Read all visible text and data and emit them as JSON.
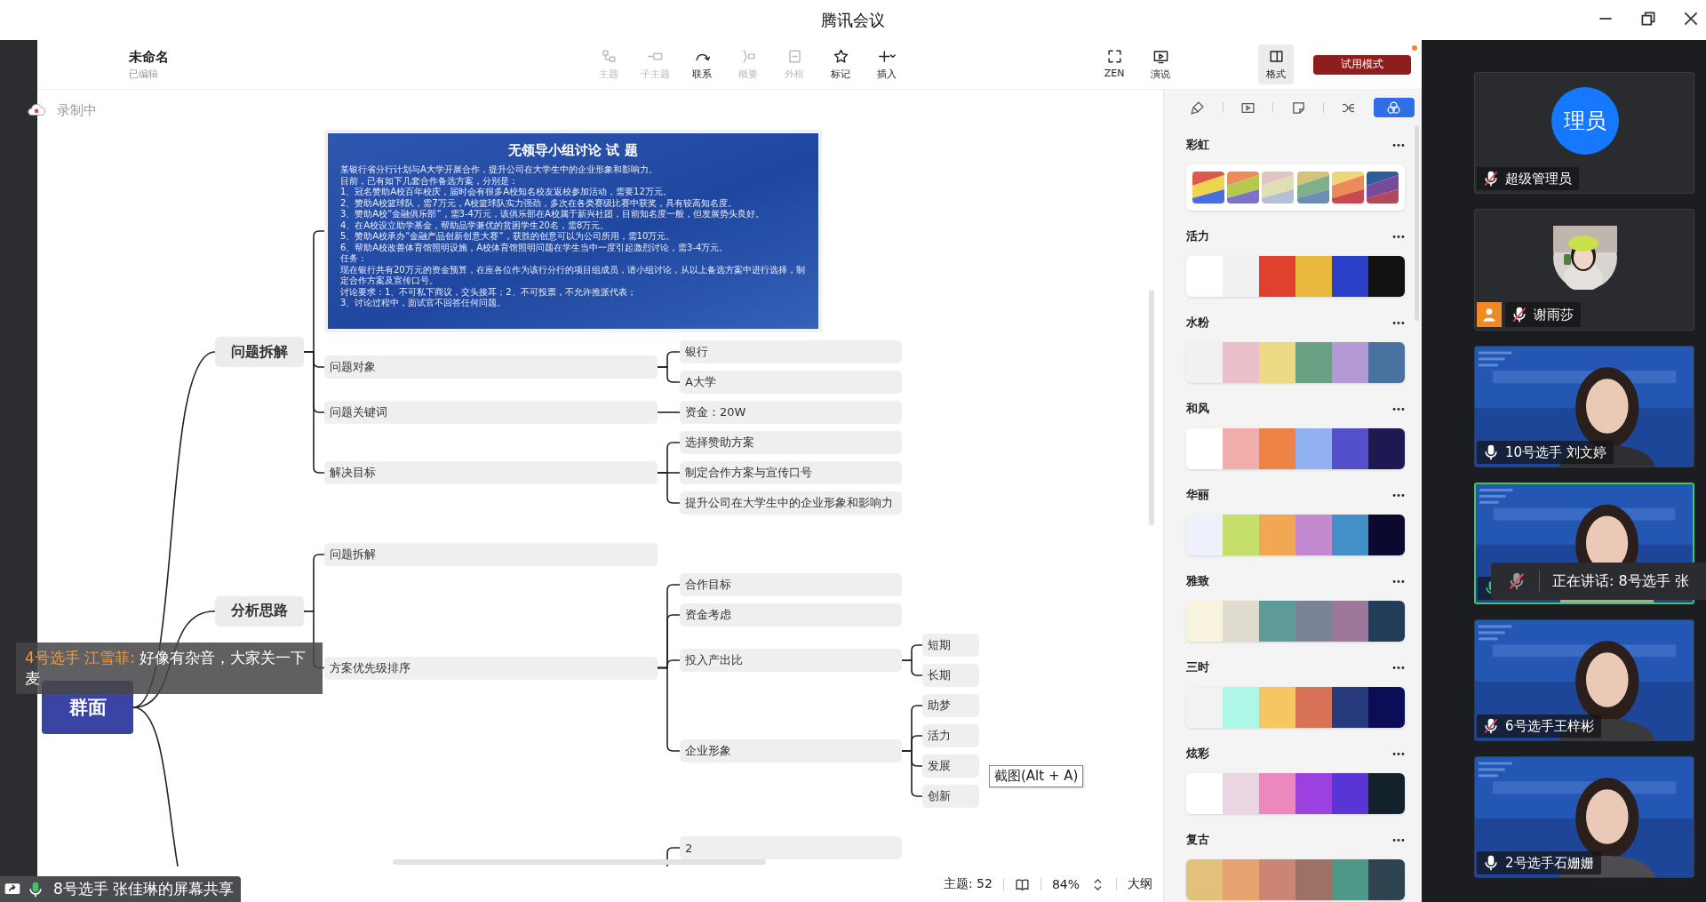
{
  "window": {
    "title": "腾讯会议"
  },
  "document": {
    "title": "未命名",
    "status": "已编辑"
  },
  "toolbar": {
    "tools": [
      {
        "label": "主题",
        "disabled": true
      },
      {
        "label": "子主题",
        "disabled": true
      },
      {
        "label": "联系",
        "disabled": false
      },
      {
        "label": "概要",
        "disabled": true
      },
      {
        "label": "外框",
        "disabled": true
      },
      {
        "label": "标记",
        "disabled": false
      },
      {
        "label": "插入",
        "disabled": false
      }
    ],
    "view_tools": [
      {
        "label": "ZEN"
      },
      {
        "label": "演说"
      }
    ],
    "format_tab": {
      "label": "格式",
      "selected": true
    },
    "trial_button": {
      "label": "试用模式",
      "notice": true
    }
  },
  "recording": {
    "label": "录制中"
  },
  "mindmap": {
    "root": {
      "kind": "topic",
      "text": "群面",
      "children": [
        {
          "kind": "topic",
          "text": "问题拆解",
          "children": [
            {
              "kind": "slide",
              "title": "无领导小组讨论 试 题",
              "lines": [
                "某银行省分行计划与A大学开展合作，提升公司在大学生中的企业形象和影响力。",
                "目前，已有如下几套合作备选方案，分别是：",
                "1、冠名赞助A校百年校庆，届时会有很多A校知名校友返校参加活动，需要12万元。",
                "2、赞助A校篮球队，需7万元，A校篮球队实力强劲，多次在各类赛级比赛中获奖，具有较高知名度。",
                "3、赞助A校“金融俱乐部”，需3-4万元，该俱乐部在A校属于新兴社团，目前知名度一般，但发展势头良好。",
                "4、在A校设立助学基金，帮助品学兼优的贫困学生20名，需8万元。",
                "5、赞助A校承办“金融产品创新创意大赛”，获胜的创意可以为公司所用，需10万元。",
                "6、帮助A校改善体育馆照明设施，A校体育馆照明问题在学生当中一度引起激烈讨论，需3-4万元。",
                "任务：",
                "现在银行共有20万元的资金预算，在座各位作为该行分行的项目组成员，请小组讨论，从以上备选方案中进行选择，制定合作方案及宣传口号。",
                "讨论要求：1、不可私下商议，交头接耳；2、不可投票，不允许推派代表；",
                "3、讨论过程中，面试官不回答任何问题。"
              ]
            },
            {
              "kind": "topic",
              "text": "问题对象",
              "children": [
                {
                  "kind": "topic",
                  "text": "银行"
                },
                {
                  "kind": "topic",
                  "text": "A大学"
                }
              ]
            },
            {
              "kind": "topic",
              "text": "问题关键词",
              "children": [
                {
                  "kind": "topic",
                  "text": "资金：20W"
                }
              ]
            },
            {
              "kind": "topic",
              "text": "解决目标",
              "children": [
                {
                  "kind": "topic",
                  "text": "选择赞助方案"
                },
                {
                  "kind": "topic",
                  "text": "制定合作方案与宣传口号"
                },
                {
                  "kind": "topic",
                  "text": "提升公司在大学生中的企业形象和影响力"
                }
              ]
            }
          ]
        },
        {
          "kind": "topic",
          "text": "分析思路",
          "children": [
            {
              "kind": "topic",
              "text": "问题拆解"
            },
            {
              "kind": "topic",
              "text": "方案优先级排序",
              "children": [
                {
                  "kind": "topic",
                  "text": "合作目标"
                },
                {
                  "kind": "topic",
                  "text": "资金考虑"
                },
                {
                  "kind": "topic",
                  "text": "投入产出比",
                  "children": [
                    {
                      "kind": "topic",
                      "text": "短期"
                    },
                    {
                      "kind": "topic",
                      "text": "长期"
                    }
                  ]
                },
                {
                  "kind": "topic",
                  "text": "企业形象",
                  "children": [
                    {
                      "kind": "topic",
                      "text": "助梦"
                    },
                    {
                      "kind": "topic",
                      "text": "活力"
                    },
                    {
                      "kind": "topic",
                      "text": "发展"
                    },
                    {
                      "kind": "topic",
                      "text": "创新"
                    }
                  ]
                }
              ]
            }
          ]
        },
        {
          "kind": "offscreen",
          "children": [
            {
              "kind": "offscreen",
              "children": [
                {
                  "kind": "topic",
                  "text": "2"
                }
              ]
            }
          ]
        }
      ]
    }
  },
  "screenshot_tooltip": "截图(Alt + A)",
  "status_bar": {
    "topic_count": "主题: 52",
    "zoom": "84%",
    "outline": "大纲"
  },
  "format_panel": {
    "tabs": [
      {
        "selected": false
      },
      {
        "selected": false
      },
      {
        "selected": false
      },
      {
        "selected": false
      },
      {
        "selected": true
      }
    ],
    "palettes": [
      {
        "name": "彩虹",
        "kind": "striped",
        "swatches": [
          {
            "bands": [
              {
                "color": "#e2574c"
              },
              {
                "color": "#eed54f"
              },
              {
                "color": "#4a6ee0"
              }
            ]
          },
          {
            "bands": [
              {
                "color": "#ed8b5b"
              },
              {
                "color": "#b6c94d"
              },
              {
                "color": "#7b74c4"
              }
            ]
          },
          {
            "bands": [
              {
                "color": "#e4c3c3"
              },
              {
                "color": "#dfe0b4"
              },
              {
                "color": "#b5c0d4"
              }
            ]
          },
          {
            "bands": [
              {
                "color": "#d6c27a"
              },
              {
                "color": "#7fb08a"
              },
              {
                "color": "#6a8fb0"
              }
            ]
          },
          {
            "bands": [
              {
                "color": "#efd67a"
              },
              {
                "color": "#ec8a5a"
              },
              {
                "color": "#c84a50"
              }
            ]
          },
          {
            "bands": [
              {
                "color": "#2f5d9a"
              },
              {
                "color": "#7a4a9a"
              },
              {
                "color": "#b04a5a"
              }
            ]
          }
        ]
      },
      {
        "name": "活力",
        "kind": "solid",
        "swatches": [
          {
            "color": "#ffffff"
          },
          {
            "color": "#f1f1f1"
          },
          {
            "color": "#e0412e"
          },
          {
            "color": "#e8b93d"
          },
          {
            "color": "#2b40c9"
          },
          {
            "color": "#111111"
          }
        ]
      },
      {
        "name": "水粉",
        "kind": "solid",
        "swatches": [
          {
            "color": "#f1f1f1"
          },
          {
            "color": "#ebbfca"
          },
          {
            "color": "#ecd983"
          },
          {
            "color": "#6aa184"
          },
          {
            "color": "#b49ad5"
          },
          {
            "color": "#4a72a1"
          }
        ]
      },
      {
        "name": "和风",
        "kind": "solid",
        "swatches": [
          {
            "color": "#ffffff"
          },
          {
            "color": "#f1aeab"
          },
          {
            "color": "#ee8346"
          },
          {
            "color": "#92b0f2"
          },
          {
            "color": "#5450cb"
          },
          {
            "color": "#1c1953"
          }
        ]
      },
      {
        "name": "华丽",
        "kind": "solid",
        "swatches": [
          {
            "color": "#eef0fb"
          },
          {
            "color": "#c5e06a"
          },
          {
            "color": "#f2a753"
          },
          {
            "color": "#c48ad0"
          },
          {
            "color": "#4390c9"
          },
          {
            "color": "#0b0a2e"
          }
        ]
      },
      {
        "name": "雅致",
        "kind": "solid",
        "swatches": [
          {
            "color": "#f7f3df"
          },
          {
            "color": "#dfdccf"
          },
          {
            "color": "#5e9a98"
          },
          {
            "color": "#7b8398"
          },
          {
            "color": "#9c789b"
          },
          {
            "color": "#233c57"
          }
        ]
      },
      {
        "name": "三时",
        "kind": "solid",
        "swatches": [
          {
            "color": "#f2f2f2"
          },
          {
            "color": "#aef6e5"
          },
          {
            "color": "#f4c763"
          },
          {
            "color": "#d77257"
          },
          {
            "color": "#263a7d"
          },
          {
            "color": "#0b0d57"
          }
        ]
      },
      {
        "name": "炫彩",
        "kind": "solid",
        "swatches": [
          {
            "color": "#ffffff"
          },
          {
            "color": "#ead6e3"
          },
          {
            "color": "#ec88bd"
          },
          {
            "color": "#9b41e0"
          },
          {
            "color": "#5a35d6"
          },
          {
            "color": "#13222a"
          }
        ]
      },
      {
        "name": "复古",
        "kind": "solid",
        "swatches": [
          {
            "color": "#e2c27a"
          },
          {
            "color": "#e6a36f"
          },
          {
            "color": "#cd8573"
          },
          {
            "color": "#9d7265"
          },
          {
            "color": "#4e9888"
          },
          {
            "color": "#2e4451"
          }
        ]
      }
    ]
  },
  "participants": [
    {
      "kind": "avatar",
      "avatar_text": "理员",
      "name": "超级管理员",
      "muted": true,
      "guest": false,
      "speaking": false
    },
    {
      "name": "谢雨莎",
      "muted": true,
      "guest": true,
      "speaking": false
    },
    {
      "kind": "video",
      "name": "10号选手 刘文婷",
      "muted": false,
      "guest": false,
      "speaking": false
    },
    {
      "kind": "video",
      "muted": false,
      "guest": false,
      "speaking": true
    },
    {
      "kind": "video",
      "name": "6号选手王梓彬",
      "muted": true,
      "guest": false,
      "speaking": false
    },
    {
      "kind": "video",
      "name": "2号选手石姗姗",
      "muted": false,
      "guest": false,
      "speaking": false
    }
  ],
  "speaking_toast": {
    "label": "正在讲话: 8号选手 张"
  },
  "chat_toast": {
    "sender": "4号选手 江雪菲:",
    "message": "好像有杂音，大家关一下麦"
  },
  "share_banner": {
    "label": "8号选手 张佳琳的屏幕共享"
  }
}
